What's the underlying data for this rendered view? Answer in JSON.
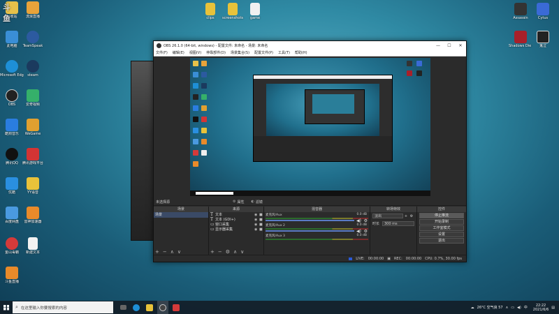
{
  "desktop": {
    "left_icons": [
      {
        "label": "回收站",
        "color": "#e6c14a"
      },
      {
        "label": "流浪直播",
        "color": "#e8a33a"
      },
      {
        "label": "此电脑",
        "color": "#3a8ed6"
      },
      {
        "label": "TeamSpeak",
        "color": "#2c5aa0"
      },
      {
        "label": "Microsoft Edge",
        "color": "#1e8fd6"
      },
      {
        "label": "steam",
        "color": "#1b3a5e"
      },
      {
        "label": "OBS",
        "color": "#222222"
      },
      {
        "label": "爱奇视频",
        "color": "#35b06a"
      },
      {
        "label": "酷狗音乐",
        "color": "#2a7de0"
      },
      {
        "label": "WeGame",
        "color": "#e0a030"
      },
      {
        "label": "腾讯QQ",
        "color": "#111111"
      },
      {
        "label": "腾讯游戏平台",
        "color": "#d33434"
      },
      {
        "label": "优酷",
        "color": "#2a8fe0"
      },
      {
        "label": "YY语音",
        "color": "#e8c23a"
      },
      {
        "label": "百度网盘",
        "color": "#4a9ae0"
      },
      {
        "label": "雷神加速器",
        "color": "#e88a2a"
      },
      {
        "label": "金山毒霸",
        "color": "#d43a3a"
      },
      {
        "label": "新建文本",
        "color": "#f2f2f2"
      },
      {
        "label": "斗鱼直播",
        "color": "#e88a2a"
      }
    ],
    "top_icons": [
      {
        "label": "clips",
        "color": "#e8c23a"
      },
      {
        "label": "screenshots",
        "color": "#e8c23a"
      },
      {
        "label": "game",
        "color": "#f0f0f0"
      }
    ],
    "right_icons": [
      {
        "label": "Assassin",
        "color": "#333333"
      },
      {
        "label": "Cytus",
        "color": "#3a6ad6"
      },
      {
        "label": "Shadows Die Twice",
        "color": "#a8202a"
      },
      {
        "label": "鬼泣",
        "color": "#222222"
      }
    ],
    "watermark": "斗鱼"
  },
  "obs": {
    "title": "OBS 26.1.0 (64-bit, windows) - 配置文件: 未命名 - 场景: 未命名",
    "window_controls": [
      "—",
      "☐",
      "✕"
    ],
    "menu": [
      "文件(F)",
      "编辑(E)",
      "视图(V)",
      "停靠部件(D)",
      "场景集合(S)",
      "配置文件(P)",
      "工具(T)",
      "帮助(H)"
    ],
    "toolbar": {
      "no_scene": "未选择源",
      "properties": "属性",
      "filters": "滤镜"
    },
    "docks": {
      "scenes": {
        "header": "场景",
        "items": [
          "场景"
        ]
      },
      "sources": {
        "header": "来源",
        "items": [
          {
            "icon": "T",
            "name": "文本"
          },
          {
            "icon": "T",
            "name": "文本 (GDI+)"
          },
          {
            "icon": "▭",
            "name": "窗口采集"
          },
          {
            "icon": "▭",
            "name": "显示器采集"
          }
        ]
      },
      "mixer": {
        "header": "混音器",
        "tracks": [
          {
            "name": "麦克风/Aux",
            "db": "0.0 dB"
          },
          {
            "name": "麦克风/Aux 2",
            "db": "0.0 dB"
          },
          {
            "name": "麦克风/Aux 3",
            "db": "0.0 dB"
          }
        ]
      },
      "transitions": {
        "header": "转场特效",
        "type": "淡出",
        "duration_label": "时长",
        "duration": "300 ms"
      },
      "controls": {
        "header": "控件",
        "buttons": [
          "停止推流",
          "开始录制",
          "工作室模式",
          "设置",
          "退出"
        ]
      }
    },
    "status": {
      "live_label": "LIVE:",
      "live_time": "00:00:00",
      "rec_label": "REC:",
      "rec_time": "00:00:00",
      "cpu": "CPU: 0.7%, 30.00 fps"
    }
  },
  "taskbar": {
    "search_placeholder": "在这里输入你要搜索的内容",
    "weather": "26°C 空气良 57",
    "time": "22:22",
    "date": "2021/6/6",
    "apps": [
      {
        "name": "task-view",
        "color": "#666666"
      },
      {
        "name": "edge",
        "color": "#1e8fd6"
      },
      {
        "name": "explorer",
        "color": "#e8c23a"
      },
      {
        "name": "obs",
        "color": "#444444"
      },
      {
        "name": "recorder",
        "color": "#d43a3a"
      }
    ]
  }
}
